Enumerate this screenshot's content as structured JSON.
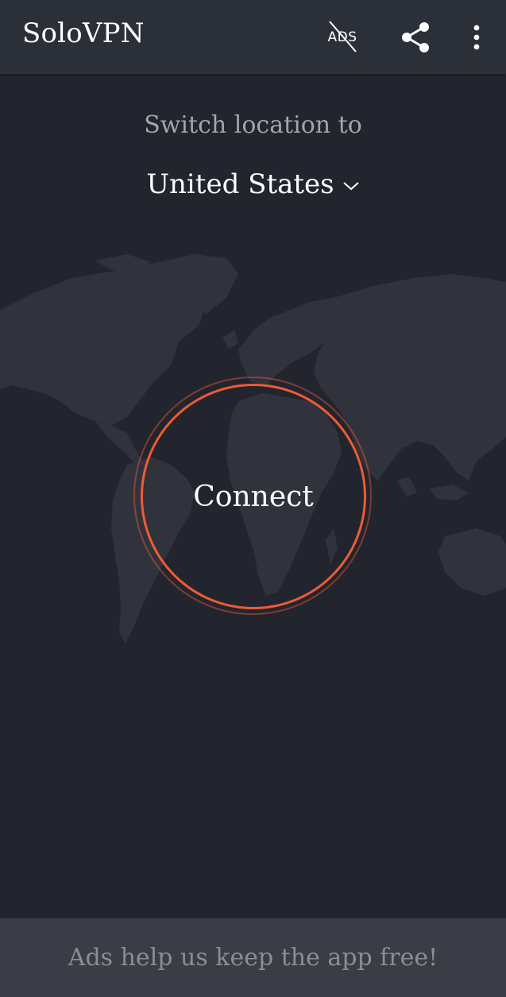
{
  "header": {
    "title": "SoloVPN",
    "ads_icon_text": "ADS",
    "icons": [
      "no-ads-icon",
      "share-icon",
      "more-vertical-icon"
    ]
  },
  "location": {
    "label": "Switch location to",
    "selected": "United States",
    "dropdown_icon": "chevron-down-icon"
  },
  "connect": {
    "label": "Connect",
    "ring_color": "#ee5b35"
  },
  "footer": {
    "ad_text": "Ads help us keep the app free!"
  },
  "colors": {
    "background": "#22252e",
    "toolbar": "#2b2f38",
    "map": "#30333c",
    "accent": "#ee5b35",
    "ad_banner": "#3a3d46"
  }
}
